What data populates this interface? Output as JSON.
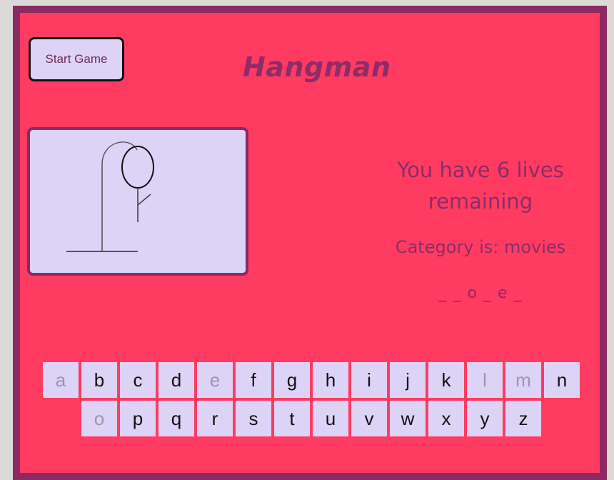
{
  "header": {
    "start_button_label": "Start Game",
    "title": "Hangman"
  },
  "status": {
    "lives_text": "You have 6 lives remaining",
    "category_text": "Category is: movies",
    "word_display": "_ _ o _ e _"
  },
  "gallows": {
    "parts_drawn": [
      "base",
      "pole",
      "rope-hook",
      "head",
      "body",
      "left-arm"
    ]
  },
  "keyboard": {
    "row1": [
      {
        "letter": "a",
        "used": true
      },
      {
        "letter": "b",
        "used": false
      },
      {
        "letter": "c",
        "used": false
      },
      {
        "letter": "d",
        "used": false
      },
      {
        "letter": "e",
        "used": true
      },
      {
        "letter": "f",
        "used": false
      },
      {
        "letter": "g",
        "used": false
      },
      {
        "letter": "h",
        "used": false
      },
      {
        "letter": "i",
        "used": false
      },
      {
        "letter": "j",
        "used": false
      },
      {
        "letter": "k",
        "used": false
      },
      {
        "letter": "l",
        "used": true
      },
      {
        "letter": "m",
        "used": true
      },
      {
        "letter": "n",
        "used": false
      }
    ],
    "row2": [
      {
        "letter": "o",
        "used": true
      },
      {
        "letter": "p",
        "used": false
      },
      {
        "letter": "q",
        "used": false
      },
      {
        "letter": "r",
        "used": false
      },
      {
        "letter": "s",
        "used": false
      },
      {
        "letter": "t",
        "used": false
      },
      {
        "letter": "u",
        "used": false
      },
      {
        "letter": "v",
        "used": false
      },
      {
        "letter": "w",
        "used": false
      },
      {
        "letter": "x",
        "used": false
      },
      {
        "letter": "y",
        "used": false
      },
      {
        "letter": "z",
        "used": false
      }
    ]
  },
  "colors": {
    "background": "#ff3b62",
    "border": "#8b2a63",
    "panel": "#dcd3f6",
    "text_accent": "#8d2c66",
    "used_key_text": "#9c97aa"
  }
}
